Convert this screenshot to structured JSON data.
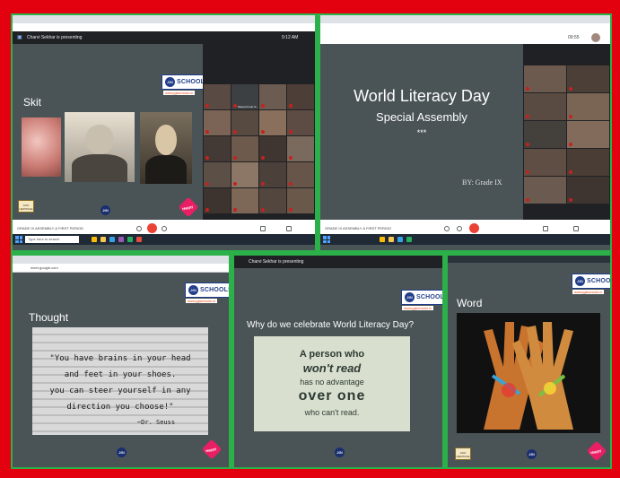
{
  "meet_top_left": {
    "presenting": "Charvi Sekhar is presenting",
    "time": "9:12 AM",
    "section_title": "Skit",
    "bottom_bar": "GRADE IX ASSEMBLY & FIRST PERIOD",
    "taskbar_search": "Type here to search",
    "tiles": [
      {
        "name": ""
      },
      {
        "name": "Saeej Kumar G..."
      },
      {
        "name": ""
      },
      {
        "name": ""
      },
      {
        "name": ""
      },
      {
        "name": ""
      },
      {
        "name": ""
      },
      {
        "name": ""
      },
      {
        "name": ""
      },
      {
        "name": ""
      },
      {
        "name": ""
      },
      {
        "name": ""
      },
      {
        "name": ""
      },
      {
        "name": ""
      },
      {
        "name": ""
      },
      {
        "name": ""
      },
      {
        "name": ""
      },
      {
        "name": ""
      },
      {
        "name": ""
      },
      {
        "name": ""
      }
    ]
  },
  "meet_top_right": {
    "title_line1": "World Literacy Day",
    "title_line2": "Special Assembly",
    "stars": "***",
    "by_line": "BY: Grade IX",
    "time": "09:55",
    "bottom_bar": "GRADE IX ASSEMBLY & FIRST PERIOD"
  },
  "bottom_left": {
    "url": "meet.google.com",
    "section_title": "Thought",
    "quote_lines": [
      "\"You have brains in your head",
      "and feet in your shoes.",
      "you can steer yourself in any",
      "direction you choose!\"",
      "~Dr. Seuss"
    ]
  },
  "bottom_middle": {
    "presenting": "Charvi Sekhar is presenting",
    "question": "Why do we celebrate World Literacy Day?",
    "card_lines": [
      "A person who",
      "won't read",
      "has no advantage",
      "over one",
      "who can't read."
    ]
  },
  "bottom_right": {
    "section_title": "Word"
  },
  "branding": {
    "logo_text": "SCHOOLS",
    "logo_disc": "JGI",
    "url": "www.jgischools.in",
    "badge": "JAIN HERITAGE",
    "jgi": "JGI",
    "heart": "Happy"
  },
  "colors": {
    "frame": "#e3000f",
    "divider": "#2bb04a",
    "slide_bg": "#4a5457",
    "end_call": "#ea4335"
  }
}
